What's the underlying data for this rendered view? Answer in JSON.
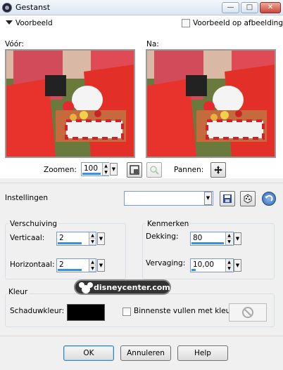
{
  "window": {
    "title": "Gestanst",
    "min_glyph": "—",
    "max_glyph": "□",
    "close_glyph": "✕"
  },
  "preview": {
    "section_label": "Voorbeeld",
    "preview_on_image_label": "Voorbeeld op afbeelding",
    "before_label": "Vóór:",
    "after_label": "Na:"
  },
  "zoom": {
    "label": "Zoomen:",
    "value": "100",
    "pan_label": "Pannen:"
  },
  "settings": {
    "label": "Instellingen",
    "preset_value": ""
  },
  "offset": {
    "title": "Verschuiving",
    "vertical_label": "Verticaal:",
    "vertical_value": "2",
    "horizontal_label": "Horizontaal:",
    "horizontal_value": "2"
  },
  "properties": {
    "title": "Kenmerken",
    "opacity_label": "Dekking:",
    "opacity_value": "80",
    "opacity_fraction": 0.8,
    "blur_label": "Vervaging:",
    "blur_value": "10,00",
    "blur_fraction": 0.1
  },
  "color": {
    "title": "Kleur",
    "shadow_color_label": "Schaduwkleur:",
    "shadow_color": "#000000",
    "fill_inside_label": "Binnenste vullen met kleur:"
  },
  "watermark": {
    "text": "disneycenter.com"
  },
  "buttons": {
    "ok": "OK",
    "cancel": "Annuleren",
    "help": "Help"
  }
}
